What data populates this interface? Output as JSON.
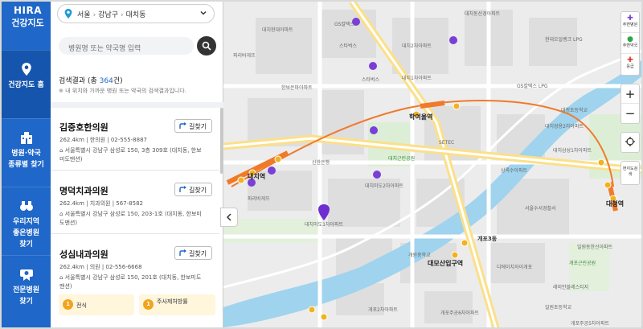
{
  "rail": {
    "logo_line1": "HIRA",
    "logo_line2": "건강지도",
    "items": [
      {
        "label": "건강지도 홈"
      },
      {
        "label1": "병원·약국",
        "label2": "종류별 찾기"
      },
      {
        "label1": "우리지역",
        "label2": "좋은병원",
        "label3": "찾기"
      },
      {
        "label1": "전문병원",
        "label2": "찾기"
      }
    ]
  },
  "location": {
    "city": "서울",
    "district": "강남구",
    "dong": "대치동"
  },
  "search": {
    "placeholder": "병원명 또는 약국명 입력"
  },
  "results": {
    "prefix": "검색결과 (총 ",
    "count": "364",
    "suffix": "건)",
    "note": "※ 내 위치와 가까운 병원 또는 약국의 검색결과입니다."
  },
  "directions_label": "길찾기",
  "hospitals": [
    {
      "name": "김중호한의원",
      "meta": "262.4km  |  한의원  |  02-555-8887",
      "address": "서울특별시 강남구 삼성로 150, 3층 309호 (대치동, 한보미도맨션)"
    },
    {
      "name": "명덕치과의원",
      "meta": "262.4km  |  치과의원  |  567-8582",
      "address": "서울특별시 강남구 삼성로 150, 203-1호 (대치동, 한보미도맨션)"
    },
    {
      "name": "성심내과의원",
      "meta": "262.4km  |  의원  |  02-556-6668",
      "address": "서울특별시 강남구 삼성로 150, 201호 (대치동, 한보미도맨션)"
    }
  ],
  "legend": [
    {
      "num": "1",
      "label": "전식"
    },
    {
      "num": "1",
      "label": "주사제처방률"
    }
  ],
  "map_tools": {
    "hospital": "주변병원",
    "pharmacy": "주변약국",
    "emergency": "응급",
    "zoom_in": "+",
    "zoom_out": "−",
    "locate": "현지도검색"
  },
  "map_labels": {
    "stations": [
      "대치역",
      "학여울역",
      "대청역",
      "대모산입구역"
    ],
    "places": [
      "GS칼텍스",
      "스타벅스",
      "스타벅스",
      "파리바게뜨",
      "파리바게뜨",
      "신한은행",
      "현대오일뱅크 LPG",
      "GS칼텍스 LPG",
      "대치근린공원",
      "SETEC",
      "개포3동",
      "개원중학교",
      "대청초등학교",
      "서울수서경찰서",
      "일원초등학교",
      "개포근린공원"
    ],
    "apartments": [
      "대치미도1차아파트",
      "대치미도2차아파트",
      "한보은마아파트",
      "대치1차아파트",
      "대치2차아파트",
      "디에이치자이개포",
      "개포2차아파트",
      "래미안블레스티지",
      "대치삼성1차아파트",
      "일원동한신아파트",
      "상록수아파트",
      "대치현대아파트",
      "대치동선경아파트",
      "대치쌍용2차아파트",
      "개포주공6차아파트",
      "개포주공5차아파트"
    ]
  }
}
